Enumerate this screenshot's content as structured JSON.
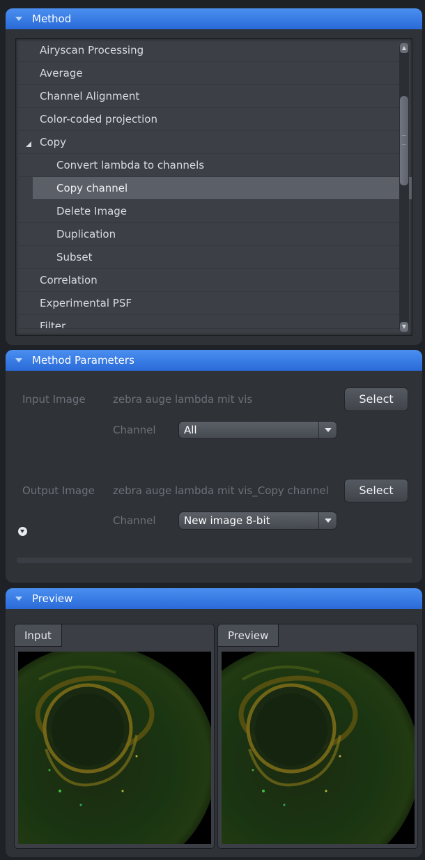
{
  "method": {
    "title": "Method",
    "items": [
      {
        "label": "Airyscan Processing",
        "level": 0
      },
      {
        "label": "Average",
        "level": 0
      },
      {
        "label": "Channel Alignment",
        "level": 0
      },
      {
        "label": "Color-coded projection",
        "level": 0
      },
      {
        "label": "Copy",
        "level": 0,
        "expanded": true
      },
      {
        "label": "Convert lambda to channels",
        "level": 1
      },
      {
        "label": "Copy channel",
        "level": 1,
        "selected": true
      },
      {
        "label": "Delete Image",
        "level": 1
      },
      {
        "label": "Duplication",
        "level": 1
      },
      {
        "label": "Subset",
        "level": 1
      },
      {
        "label": "Correlation",
        "level": 0
      },
      {
        "label": "Experimental PSF",
        "level": 0
      },
      {
        "label": "Filter",
        "level": 0
      }
    ]
  },
  "parameters": {
    "title": "Method Parameters",
    "input": {
      "label": "Input Image",
      "value": "zebra auge lambda mit vis",
      "button": "Select",
      "channel_label": "Channel",
      "channel_value": "All"
    },
    "output": {
      "label": "Output Image",
      "value": "zebra auge lambda mit vis_Copy channel",
      "button": "Select",
      "channel_label": "Channel",
      "channel_value": "New image 8-bit"
    }
  },
  "preview": {
    "title": "Preview",
    "tabs": [
      "Input",
      "Preview"
    ]
  },
  "colors": {
    "header_blue": "#3a7ee6",
    "panel_bg": "#2f3338",
    "selected_row": "#5b6068"
  }
}
